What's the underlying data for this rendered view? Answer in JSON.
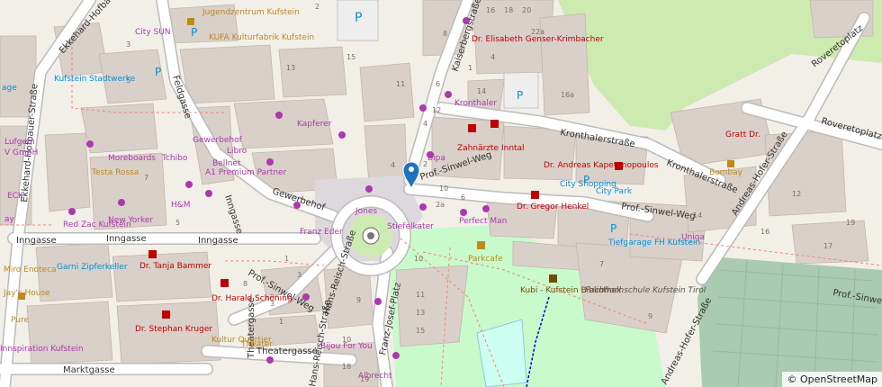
{
  "attribution": "© OpenStreetMap",
  "colors": {
    "land": "#f2efe9",
    "building": "#d9d0c9",
    "park": "#c8facc",
    "grass": "#cdebb0",
    "cemetery": "#aacbaf",
    "road": "#ffffff",
    "shop": "#ac39ac",
    "amenity": "#bd8a1e",
    "health": "#bf0000",
    "transport": "#0092da",
    "marker": "#1e73be"
  },
  "streets": [
    {
      "id": "kaiserbergstrasse",
      "text": "Kaiserbergstraße"
    },
    {
      "id": "kronthalerstrasse-1",
      "text": "Kronthalerstraße"
    },
    {
      "id": "kronthalerstrasse-2",
      "text": "Kronthalerstraße"
    },
    {
      "id": "roveretoplatz-1",
      "text": "Roveretoplatz"
    },
    {
      "id": "roveretoplatz-2",
      "text": "Roveretoplatz"
    },
    {
      "id": "andreas-hofer-1",
      "text": "Andreas-Hofer-Straße"
    },
    {
      "id": "andreas-hofer-2",
      "text": "Andreas-Hofer-Straße"
    },
    {
      "id": "ekkehard-1",
      "text": "Ekkehard-Hofbauer-Straße"
    },
    {
      "id": "ekkehard-2",
      "text": "Ekkehard-Hofbauer-Straße"
    },
    {
      "id": "feldgasse",
      "text": "Feldgasse"
    },
    {
      "id": "gewerbehof",
      "text": "Gewerbehof"
    },
    {
      "id": "inngasse-1",
      "text": "Inngasse"
    },
    {
      "id": "inngasse-2",
      "text": "Inngasse"
    },
    {
      "id": "inngasse-3",
      "text": "Inngasse"
    },
    {
      "id": "inngasse-4",
      "text": "Inngasse"
    },
    {
      "id": "sinwel-weg",
      "text": "Prof.-Sinwel-Weg"
    },
    {
      "id": "sinwel-weg-2",
      "text": "Prof.-Sinwel-Weg"
    },
    {
      "id": "sinwel-weg-3",
      "text": "Prof.-Sinwel-Weg"
    },
    {
      "id": "hans-reisch",
      "text": "Hans-Reisch-Straße"
    },
    {
      "id": "hans-reisch-2",
      "text": "Hans-Reisch-Straße"
    },
    {
      "id": "franz-josef",
      "text": "Franz-Josef-Platz"
    },
    {
      "id": "theatergasse",
      "text": "Theatergasse"
    },
    {
      "id": "theatergasse-2",
      "text": "Theatergasse"
    },
    {
      "id": "marktgasse",
      "text": "Marktgasse"
    }
  ],
  "pois": [
    {
      "id": "jugendzentrum",
      "text": "Jugendzentrum Kufstein",
      "cat": "amenity"
    },
    {
      "id": "kufa",
      "text": "KUFA Kulturfabrik Kufstein",
      "cat": "amenity"
    },
    {
      "id": "city-sun",
      "text": "City SUN",
      "cat": "shop"
    },
    {
      "id": "kufstein-stadtwerke",
      "text": "Kufstein Stadtwerke",
      "cat": "transport"
    },
    {
      "id": "kapferer",
      "text": "Kapferer",
      "cat": "shop"
    },
    {
      "id": "gewerbehof-shop",
      "text": "Gewerbehof",
      "cat": "shop"
    },
    {
      "id": "libro",
      "text": "Libro",
      "cat": "shop"
    },
    {
      "id": "bellnet",
      "text": "Bellnet",
      "cat": "shop"
    },
    {
      "id": "a1",
      "text": "A1 Premium Partner",
      "cat": "shop"
    },
    {
      "id": "moreboards",
      "text": "Moreboards",
      "cat": "shop"
    },
    {
      "id": "tchibo",
      "text": "Tchibo",
      "cat": "shop"
    },
    {
      "id": "testa-rossa",
      "text": "Testa Rossa",
      "cat": "amenity"
    },
    {
      "id": "hm",
      "text": "H&M",
      "cat": "shop"
    },
    {
      "id": "new-yorker",
      "text": "New Yorker",
      "cat": "shop"
    },
    {
      "id": "red-zac",
      "text": "Red Zac Kufstein",
      "cat": "shop"
    },
    {
      "id": "jones",
      "text": "Jones",
      "cat": "shop"
    },
    {
      "id": "franz-eder",
      "text": "Franz Eder",
      "cat": "shop"
    },
    {
      "id": "dr-gensler",
      "text": "Dr. Elisabeth Genser-Krimbacher",
      "cat": "health"
    },
    {
      "id": "kronthaler",
      "text": "Kronthaler",
      "cat": "shop"
    },
    {
      "id": "zahnaerzte",
      "text": "Zahnärzte Inntal",
      "cat": "health"
    },
    {
      "id": "bipa",
      "text": "Bipa",
      "cat": "shop"
    },
    {
      "id": "kapetanopoulos",
      "text": "Dr. Andreas Kapetanopoulos",
      "cat": "health"
    },
    {
      "id": "city-shopping",
      "text": "City Shopping",
      "cat": "transport"
    },
    {
      "id": "city-park",
      "text": "City Park",
      "cat": "transport"
    },
    {
      "id": "dr-henkel",
      "text": "Dr. Gregor Henkel",
      "cat": "health"
    },
    {
      "id": "stiefelkater",
      "text": "Stiefelkater",
      "cat": "shop"
    },
    {
      "id": "perfect-man",
      "text": "Perfect Man",
      "cat": "shop"
    },
    {
      "id": "parkcafe",
      "text": "Parkcafe",
      "cat": "amenity"
    },
    {
      "id": "uniqa",
      "text": "Uniqa",
      "cat": "shop"
    },
    {
      "id": "tiefgarage",
      "text": "Tiefgarage FH Kufstein",
      "cat": "transport"
    },
    {
      "id": "kubi",
      "text": "Kubi - Kufstein Bibliothek",
      "cat": "amenity"
    },
    {
      "id": "fh",
      "text": "Fachhochschule Kufstein Tirol",
      "cat": "school"
    },
    {
      "id": "gratt",
      "text": "Gratt Dr.",
      "cat": "health"
    },
    {
      "id": "bombay",
      "text": "Bombay",
      "cat": "amenity"
    },
    {
      "id": "garni",
      "text": "Garni Zipferkeller",
      "cat": "transport"
    },
    {
      "id": "dr-bammer",
      "text": "Dr. Tanja Bammer",
      "cat": "health"
    },
    {
      "id": "miro",
      "text": "Miro Enoteca",
      "cat": "amenity"
    },
    {
      "id": "jays-house",
      "text": "Jay's House",
      "cat": "amenity"
    },
    {
      "id": "pure",
      "text": "Pure",
      "cat": "amenity"
    },
    {
      "id": "innspiration",
      "text": "Innspiration Kufstein",
      "cat": "shop"
    },
    {
      "id": "dr-schoning",
      "text": "Dr. Harald Schöning",
      "cat": "health"
    },
    {
      "id": "dr-kruger",
      "text": "Dr. Stephan Kruger",
      "cat": "health"
    },
    {
      "id": "kultur-quartier",
      "text": "Kultur Quartier",
      "cat": "amenity"
    },
    {
      "id": "bijou",
      "text": "Bijou For You",
      "cat": "shop"
    },
    {
      "id": "albrecht",
      "text": "Albrecht",
      "cat": "shop"
    },
    {
      "id": "theater",
      "text": "Theater",
      "cat": "amenity"
    },
    {
      "id": "ecc",
      "text": "ECK",
      "cat": "shop"
    },
    {
      "id": "lufgem",
      "text": "Lufgem",
      "cat": "shop"
    },
    {
      "id": "vgmbh",
      "text": "V GmbH",
      "cat": "shop"
    },
    {
      "id": "aage",
      "text": "age",
      "cat": "transport"
    },
    {
      "id": "eay",
      "text": "ay",
      "cat": "shop"
    }
  ],
  "housenumbers": [
    "15",
    "2",
    "3",
    "5",
    "11",
    "13",
    "1",
    "4",
    "6",
    "8",
    "10",
    "12",
    "14",
    "16",
    "18",
    "20",
    "22a",
    "2a",
    "4",
    "6",
    "7",
    "9",
    "12",
    "14",
    "16a",
    "16",
    "17",
    "19",
    "2",
    "4",
    "10",
    "5",
    "7",
    "3",
    "1",
    "3",
    "1",
    "8",
    "9",
    "10",
    "11",
    "13",
    "15",
    "18",
    "19"
  ]
}
